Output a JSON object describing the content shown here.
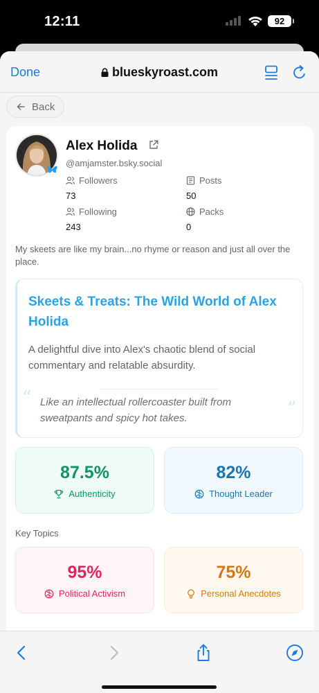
{
  "status_bar": {
    "time": "12:11",
    "battery": "92"
  },
  "browser": {
    "done_label": "Done",
    "url": "blueskyroast.com"
  },
  "page": {
    "back_label": "Back",
    "profile": {
      "name": "Alex Holida",
      "handle": "@amjamster.bsky.social",
      "stats": [
        {
          "label": "Followers",
          "value": "73",
          "icon": "users-icon"
        },
        {
          "label": "Posts",
          "value": "50",
          "icon": "posts-icon"
        },
        {
          "label": "Following",
          "value": "243",
          "icon": "users-icon"
        },
        {
          "label": "Packs",
          "value": "0",
          "icon": "globe-icon"
        }
      ],
      "bio": "My skeets are like my brain...no rhyme or reason and just all over the place."
    },
    "feature": {
      "title": "Skeets & Treats: The Wild World of Alex Holida",
      "description": "A delightful dive into Alex's chaotic blend of social commentary and relatable absurdity.",
      "quote": "Like an intellectual rollercoaster built from sweatpants and spicy hot takes."
    },
    "scores": [
      {
        "value": "87.5%",
        "label": "Authenticity",
        "icon": "trophy-icon",
        "color": "#0e9466",
        "bg": "#effbf5",
        "border": "#d7f2e5"
      },
      {
        "value": "82%",
        "label": "Thought Leader",
        "icon": "brain-icon",
        "color": "#1677b3",
        "bg": "#f1f9fe",
        "border": "#dcedf8"
      }
    ],
    "key_topics_label": "Key Topics",
    "topics": [
      {
        "value": "95%",
        "label": "Political Activism",
        "icon": "brain-icon",
        "color": "#e0245e",
        "bg": "#fff5f7",
        "border": "#fbe3e9"
      },
      {
        "value": "75%",
        "label": "Personal Anecdotes",
        "icon": "lightbulb-icon",
        "color": "#d9770c",
        "bg": "#fff9f0",
        "border": "#fbecd5"
      }
    ]
  },
  "colors": {
    "link_blue": "#1e7ae0",
    "sky_blue": "#29a3e6"
  }
}
